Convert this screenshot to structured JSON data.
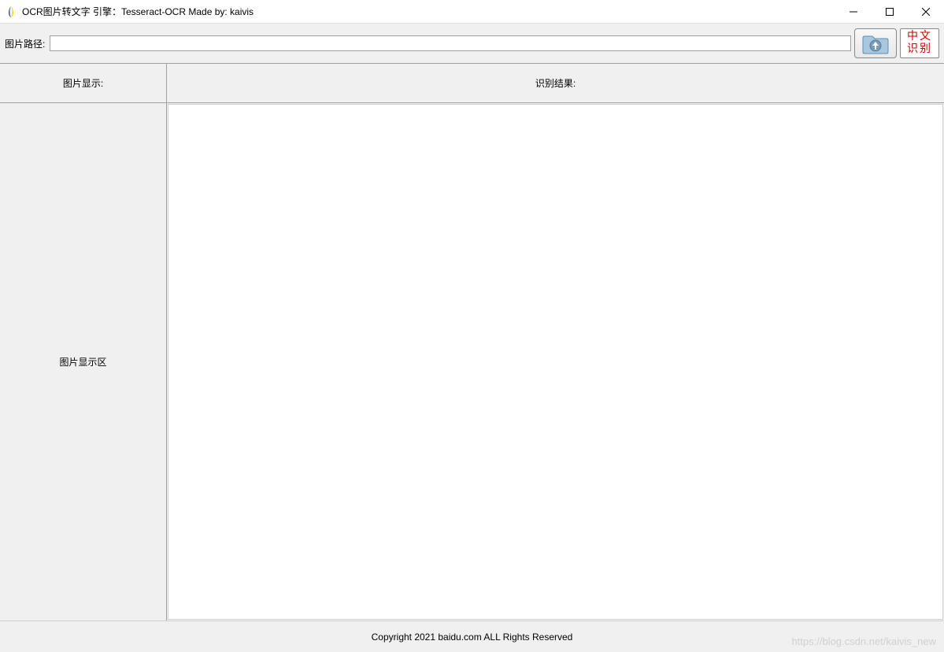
{
  "window": {
    "title": "OCR图片转文字  引擎：Tesseract-OCR  Made by: kaivis"
  },
  "toolbar": {
    "path_label": "图片路径:",
    "path_value": "",
    "recognize_line1": "中文",
    "recognize_line2": "识别"
  },
  "panels": {
    "left_header": "图片显示:",
    "left_body": "图片显示区",
    "right_header": "识别结果:"
  },
  "footer": {
    "copyright": "Copyright 2021 baidu.com ALL Rights Reserved"
  },
  "watermark": "https://blog.csdn.net/kaivis_new"
}
